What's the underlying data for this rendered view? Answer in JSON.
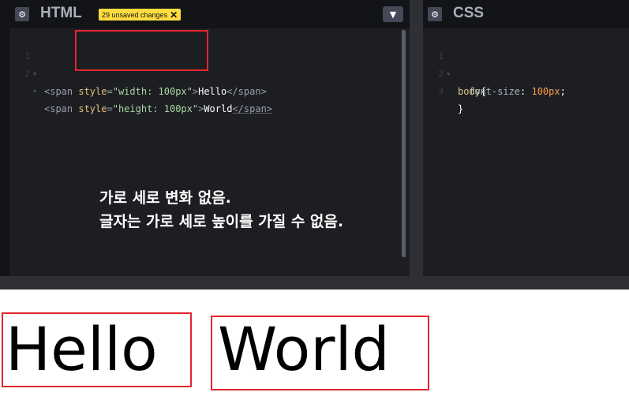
{
  "html_pane": {
    "title": "HTML",
    "settings_icon": "gear-icon",
    "unsaved_badge": "29 unsaved changes",
    "badge_close_icon": "close-icon",
    "collapse_icon": "chevron-down-icon",
    "lines": [
      {
        "no": "1",
        "open": "<span ",
        "attr": "style",
        "eq": "=",
        "value": "\"width: 100px\"",
        "close": ">",
        "text": "Hello",
        "end_tag": "</span>"
      },
      {
        "no": "2",
        "open": "<span ",
        "attr": "style",
        "eq": "=",
        "value": "\"height: 100px\"",
        "close": ">",
        "text": "World",
        "end_tag": "</span>"
      }
    ]
  },
  "css_pane": {
    "title": "CSS",
    "settings_icon": "gear-icon",
    "lines": [
      {
        "no": "1",
        "selector": "body",
        "brace": "{"
      },
      {
        "no": "2",
        "property": "font-size",
        "colon": ": ",
        "value": "100px",
        "semi": ";"
      },
      {
        "no": "3",
        "brace": "}"
      }
    ]
  },
  "annotation": {
    "line1": "가로 세로 변화 없음.",
    "line2": "글자는 가로 세로 높이를 가질 수 없음."
  },
  "preview": {
    "word1": "Hello",
    "word2": "World"
  },
  "colors": {
    "highlight": "#e3262d",
    "badge": "#ffdd40",
    "editor_bg": "#1d1e22"
  }
}
